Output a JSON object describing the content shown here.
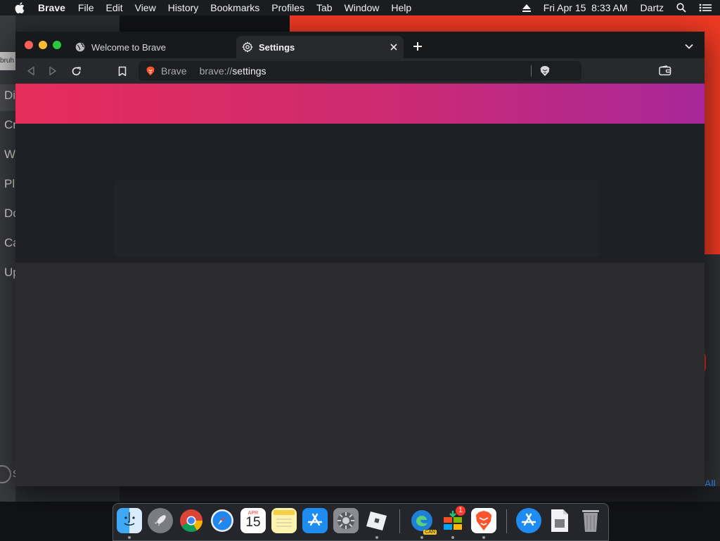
{
  "menubar": {
    "app": "Brave",
    "items": [
      "File",
      "Edit",
      "View",
      "History",
      "Bookmarks",
      "Profiles",
      "Tab",
      "Window",
      "Help"
    ],
    "datetime": "Fri Apr 15  8:33 AM",
    "user": "Dartz"
  },
  "background_app": {
    "chip": "bruh",
    "sidebar_letters": [
      "Di",
      "Cr",
      "W",
      "Pl",
      "Do",
      "Ca",
      "Up"
    ],
    "bottom_letter": "S",
    "link": "All"
  },
  "browser": {
    "tabs": [
      {
        "label": "Welcome to Brave",
        "icon": "globe-icon",
        "active": false
      },
      {
        "label": "Settings",
        "icon": "gear-icon",
        "active": true
      }
    ],
    "url": {
      "site": "Brave",
      "scheme": "brave://",
      "path": "settings"
    }
  },
  "dock": {
    "apps": [
      "Finder",
      "Launchpad",
      "Google Chrome",
      "Safari",
      "Calendar",
      "Notes",
      "App Store",
      "System Preferences",
      "Roblox",
      "Microsoft Edge Canary",
      "Microsoft Remote Desktop",
      "Brave Browser",
      "App Store",
      "Preview",
      "Trash"
    ],
    "calendar": {
      "month": "APR",
      "day": "15"
    },
    "edge_label": "CAN",
    "badge": "1"
  },
  "colors": {
    "banner_start": "#e62d5a",
    "banner_end": "#a8279a",
    "red_window": "#ee3a24"
  }
}
